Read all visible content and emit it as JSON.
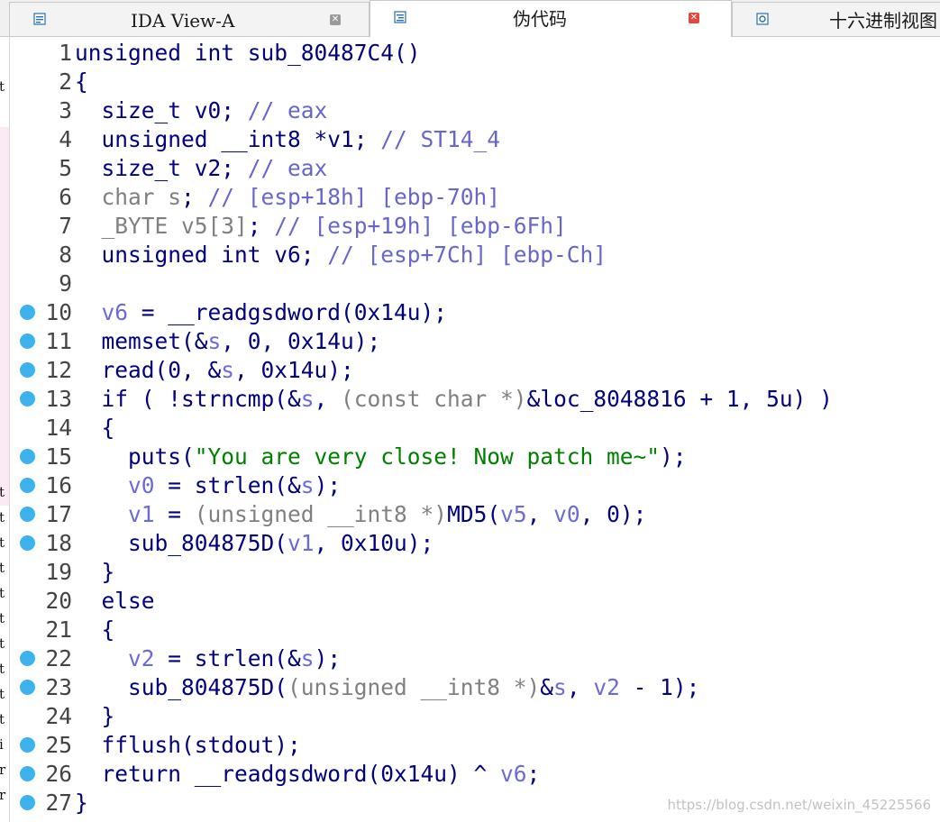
{
  "tabs": [
    {
      "title": "IDA View-A",
      "icon": "disassembly-view-icon",
      "active": false,
      "closable": true
    },
    {
      "title": "伪代码",
      "icon": "pseudocode-icon",
      "active": true,
      "closable": true
    },
    {
      "title": "十六进制视图",
      "icon": "hex-view-icon",
      "active": false,
      "closable": false
    }
  ],
  "colors": {
    "keyword": "#000080",
    "comment": "#6666cc",
    "local_var": "#6a6ad8",
    "string": "#008000",
    "breakpoint": "#3db3ee"
  },
  "left_strip_chars": [
    "t",
    "t",
    "t",
    "t",
    "t",
    "t",
    "t",
    "t",
    "t",
    "t",
    "t",
    "i",
    "r",
    "r"
  ],
  "code": {
    "lines": [
      {
        "n": "1",
        "bp": false,
        "t": "unsigned int sub_80487C4()"
      },
      {
        "n": "2",
        "bp": false,
        "t": "{"
      },
      {
        "n": "3",
        "bp": false,
        "a": "  size_t v0; ",
        "c": "// eax"
      },
      {
        "n": "4",
        "bp": false,
        "a": "  unsigned __int8 *v1; ",
        "c": "// ST14_4"
      },
      {
        "n": "5",
        "bp": false,
        "a": "  size_t v2; ",
        "c": "// eax"
      },
      {
        "n": "6",
        "bp": false,
        "g": "  char s",
        "a": "; ",
        "c": "// [esp+18h] [ebp-70h]"
      },
      {
        "n": "7",
        "bp": false,
        "g": "  _BYTE v5[3]",
        "a": "; ",
        "c": "// [esp+19h] [ebp-6Fh]"
      },
      {
        "n": "8",
        "bp": false,
        "a": "  unsigned int v6; ",
        "c": "// [esp+7Ch] [ebp-Ch]"
      },
      {
        "n": "9",
        "bp": false,
        "t": ""
      },
      {
        "n": "10",
        "bp": true,
        "t": "  v6 = __readgsdword(0x14u);"
      },
      {
        "n": "11",
        "bp": true,
        "t": "  memset(&s, 0, 0x14u);"
      },
      {
        "n": "12",
        "bp": true,
        "t": "  read(0, &s, 0x14u);"
      },
      {
        "n": "13",
        "bp": true,
        "t": "  if ( !strncmp(&s, (const char *)&loc_8048816 + 1, 5u) )"
      },
      {
        "n": "14",
        "bp": false,
        "t": "  {"
      },
      {
        "n": "15",
        "bp": true,
        "t": "    puts(\"You are very close! Now patch me~\");"
      },
      {
        "n": "16",
        "bp": true,
        "t": "    v0 = strlen(&s);"
      },
      {
        "n": "17",
        "bp": true,
        "t": "    v1 = (unsigned __int8 *)MD5(v5, v0, 0);"
      },
      {
        "n": "18",
        "bp": true,
        "t": "    sub_804875D(v1, 0x10u);"
      },
      {
        "n": "19",
        "bp": false,
        "t": "  }"
      },
      {
        "n": "20",
        "bp": false,
        "t": "  else"
      },
      {
        "n": "21",
        "bp": false,
        "t": "  {"
      },
      {
        "n": "22",
        "bp": true,
        "t": "    v2 = strlen(&s);"
      },
      {
        "n": "23",
        "bp": true,
        "t": "    sub_804875D((unsigned __int8 *)&s, v2 - 1);"
      },
      {
        "n": "24",
        "bp": false,
        "t": "  }"
      },
      {
        "n": "25",
        "bp": true,
        "t": "  fflush(stdout);"
      },
      {
        "n": "26",
        "bp": true,
        "t": "  return __readgsdword(0x14u) ^ v6;"
      },
      {
        "n": "27",
        "bp": true,
        "t": "}"
      }
    ]
  },
  "watermark": "https://blog.csdn.net/weixin_45225566"
}
